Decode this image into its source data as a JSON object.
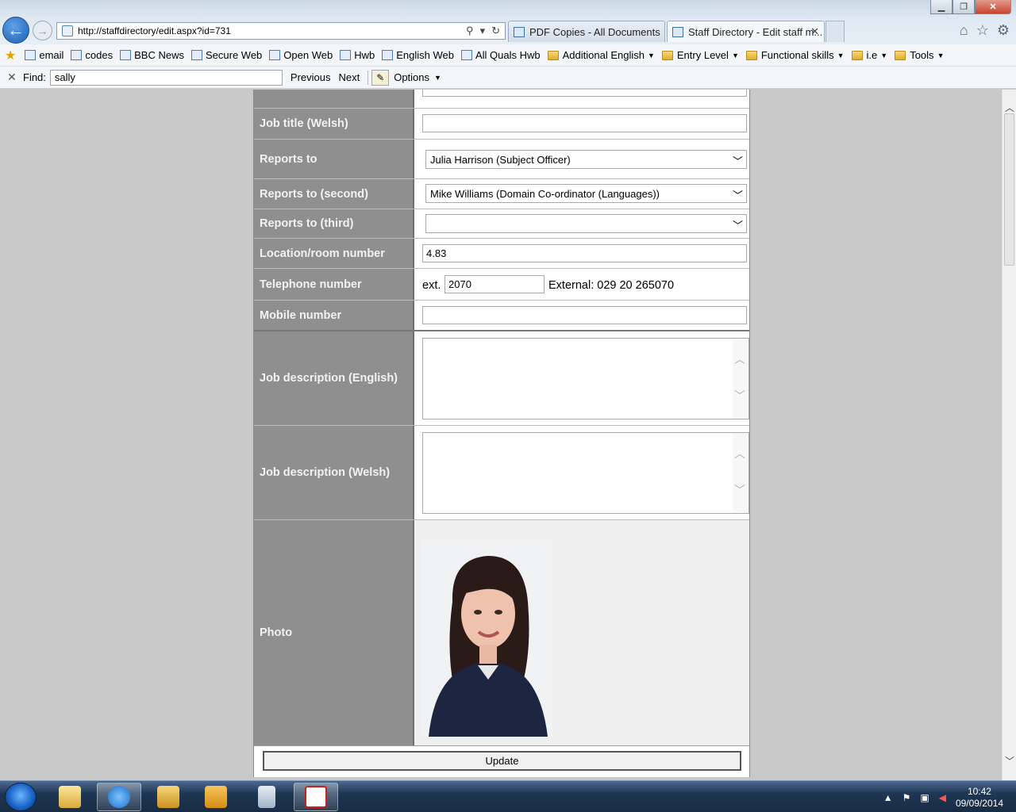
{
  "browser": {
    "address": "http://staffdirectory/edit.aspx?id=731",
    "tabs": [
      {
        "title": "PDF Copies - All Documents"
      },
      {
        "title": "Staff Directory - Edit staff m..."
      }
    ]
  },
  "favorites": [
    {
      "label": "email",
      "type": "link"
    },
    {
      "label": "codes",
      "type": "link"
    },
    {
      "label": "BBC News",
      "type": "link"
    },
    {
      "label": "Secure Web",
      "type": "link"
    },
    {
      "label": "Open Web",
      "type": "link"
    },
    {
      "label": "Hwb",
      "type": "link"
    },
    {
      "label": "English Web",
      "type": "link"
    },
    {
      "label": "All Quals Hwb",
      "type": "link"
    },
    {
      "label": "Additional English",
      "type": "folder"
    },
    {
      "label": "Entry Level",
      "type": "folder"
    },
    {
      "label": "Functional skills",
      "type": "folder"
    },
    {
      "label": "i.e",
      "type": "folder"
    },
    {
      "label": "Tools",
      "type": "folder"
    }
  ],
  "findbar": {
    "label": "Find:",
    "value": "sally",
    "previous": "Previous",
    "next": "Next",
    "options": "Options"
  },
  "form": {
    "job_title_welsh": {
      "label": "Job title (Welsh)",
      "value": ""
    },
    "reports_to": {
      "label": "Reports to",
      "value": "Julia Harrison (Subject Officer)"
    },
    "reports_to_second": {
      "label": "Reports to (second)",
      "value": "Mike Williams (Domain Co-ordinator (Languages))"
    },
    "reports_to_third": {
      "label": "Reports to (third)",
      "value": ""
    },
    "location": {
      "label": "Location/room number",
      "value": "4.83"
    },
    "telephone": {
      "label": "Telephone number",
      "ext_prefix": "ext.",
      "ext_value": "2070",
      "external": "External: 029 20 265070"
    },
    "mobile": {
      "label": "Mobile number",
      "value": ""
    },
    "job_desc_english": {
      "label": "Job description (English)",
      "value": ""
    },
    "job_desc_welsh": {
      "label": "Job description (Welsh)",
      "value": ""
    },
    "photo": {
      "label": "Photo"
    },
    "update_label": "Update"
  },
  "taskbar": {
    "time": "10:42",
    "date": "09/09/2014"
  }
}
